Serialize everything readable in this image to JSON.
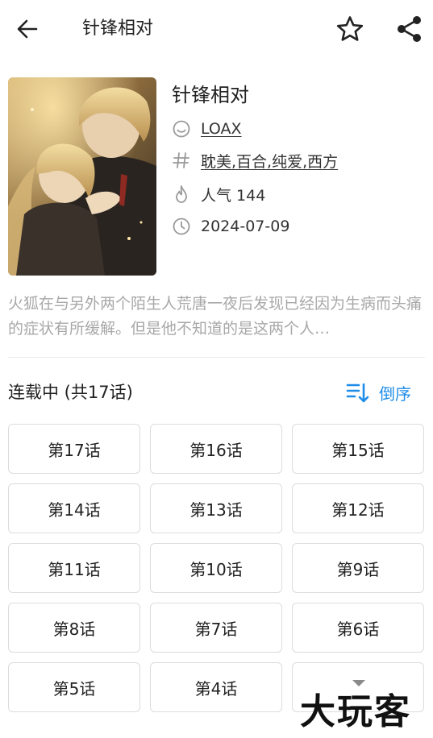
{
  "topbar": {
    "title": "针锋相对",
    "back_icon": "arrow-left-icon",
    "favorite_icon": "star-outline-icon",
    "share_icon": "share-icon"
  },
  "comic": {
    "title": "针锋相对",
    "author": "LOAX",
    "tags": "耽美,百合,纯爱,西方",
    "popularity": "人气 144",
    "date": "2024-07-09",
    "description": "火狐在与另外两个陌生人荒唐一夜后发现已经因为生病而头痛的症状有所缓解。但是他不知道的是这两个人…"
  },
  "chapters": {
    "header": "连载中 (共17话)",
    "sort_label": "倒序",
    "sort_color": "#1e8ce8",
    "items": [
      "第17话",
      "第16话",
      "第15话",
      "第14话",
      "第13话",
      "第12话",
      "第11话",
      "第10话",
      "第9话",
      "第8话",
      "第7话",
      "第6话",
      "第5话",
      "第4话"
    ]
  },
  "watermark": "大玩客"
}
